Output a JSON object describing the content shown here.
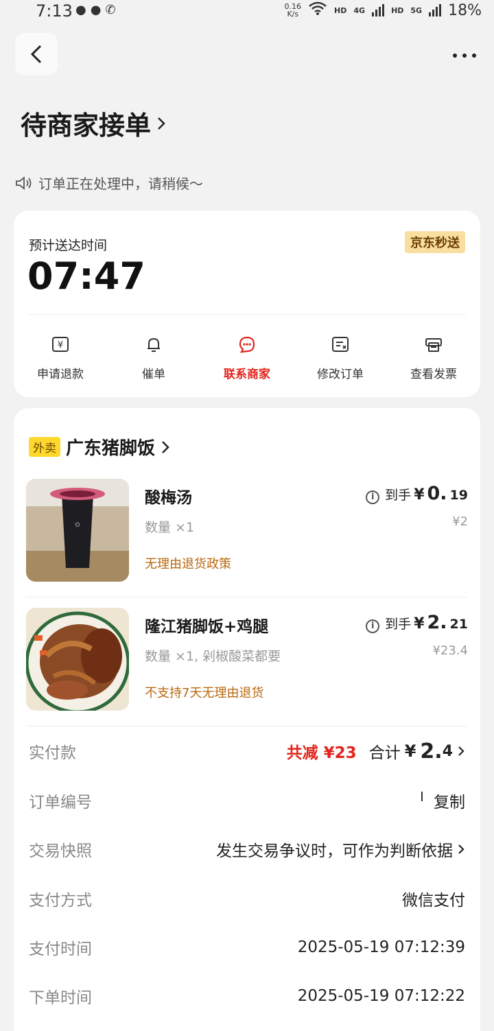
{
  "status_bar": {
    "time": "7:13",
    "net_speed_value": "0.16",
    "net_speed_unit": "K/s",
    "hd1": "HD",
    "net1": "4G",
    "hd2": "HD",
    "net2": "5G",
    "battery": "18%"
  },
  "header": {
    "title": "待商家接单",
    "notice": "订单正在处理中，请稍候～"
  },
  "delivery": {
    "eta_label": "预计送达时间",
    "eta_time": "07:47",
    "badge": "京东秒送",
    "actions": [
      {
        "label": "申请退款",
        "icon": "refund-icon"
      },
      {
        "label": "催单",
        "icon": "bell-icon"
      },
      {
        "label": "联系商家",
        "icon": "chat-icon"
      },
      {
        "label": "修改订单",
        "icon": "edit-order-icon"
      },
      {
        "label": "查看发票",
        "icon": "invoice-icon"
      }
    ]
  },
  "shop": {
    "tag": "外卖",
    "name": "广东猪脚饭"
  },
  "items": [
    {
      "name": "酸梅汤",
      "qty": "数量 ×1",
      "policy": "无理由退货政策",
      "price_prefix": "到手",
      "price_yen": "¥",
      "price_int": "0.",
      "price_dec": "19",
      "original": "¥2"
    },
    {
      "name": "隆江猪脚饭+鸡腿",
      "qty": "数量 ×1, 剁椒酸菜都要",
      "policy": "不支持7天无理由退货",
      "price_prefix": "到手",
      "price_yen": "¥",
      "price_int": "2.",
      "price_dec": "21",
      "original": "¥23.4"
    }
  ],
  "summary": {
    "paid_label": "实付款",
    "reduce_text": "共减 ¥23",
    "total_prefix": "合计",
    "total_yen": "¥",
    "total_int": "2.",
    "total_dec": "4",
    "order_no_label": "订单编号",
    "copy_label": "复制",
    "snapshot_label": "交易快照",
    "snapshot_value": "发生交易争议时，可作为判断依据",
    "pay_method_label": "支付方式",
    "pay_method_value": "微信支付",
    "pay_time_label": "支付时间",
    "pay_time_value": "2025-05-19 07:12:39",
    "order_time_label": "下单时间",
    "order_time_value": "2025-05-19 07:12:22"
  },
  "colors": {
    "accent_red": "#e1251b",
    "policy_brown": "#b8680f",
    "jd_badge_bg": "#f8dfa0",
    "waimai_tag_bg": "#ffd82e"
  }
}
